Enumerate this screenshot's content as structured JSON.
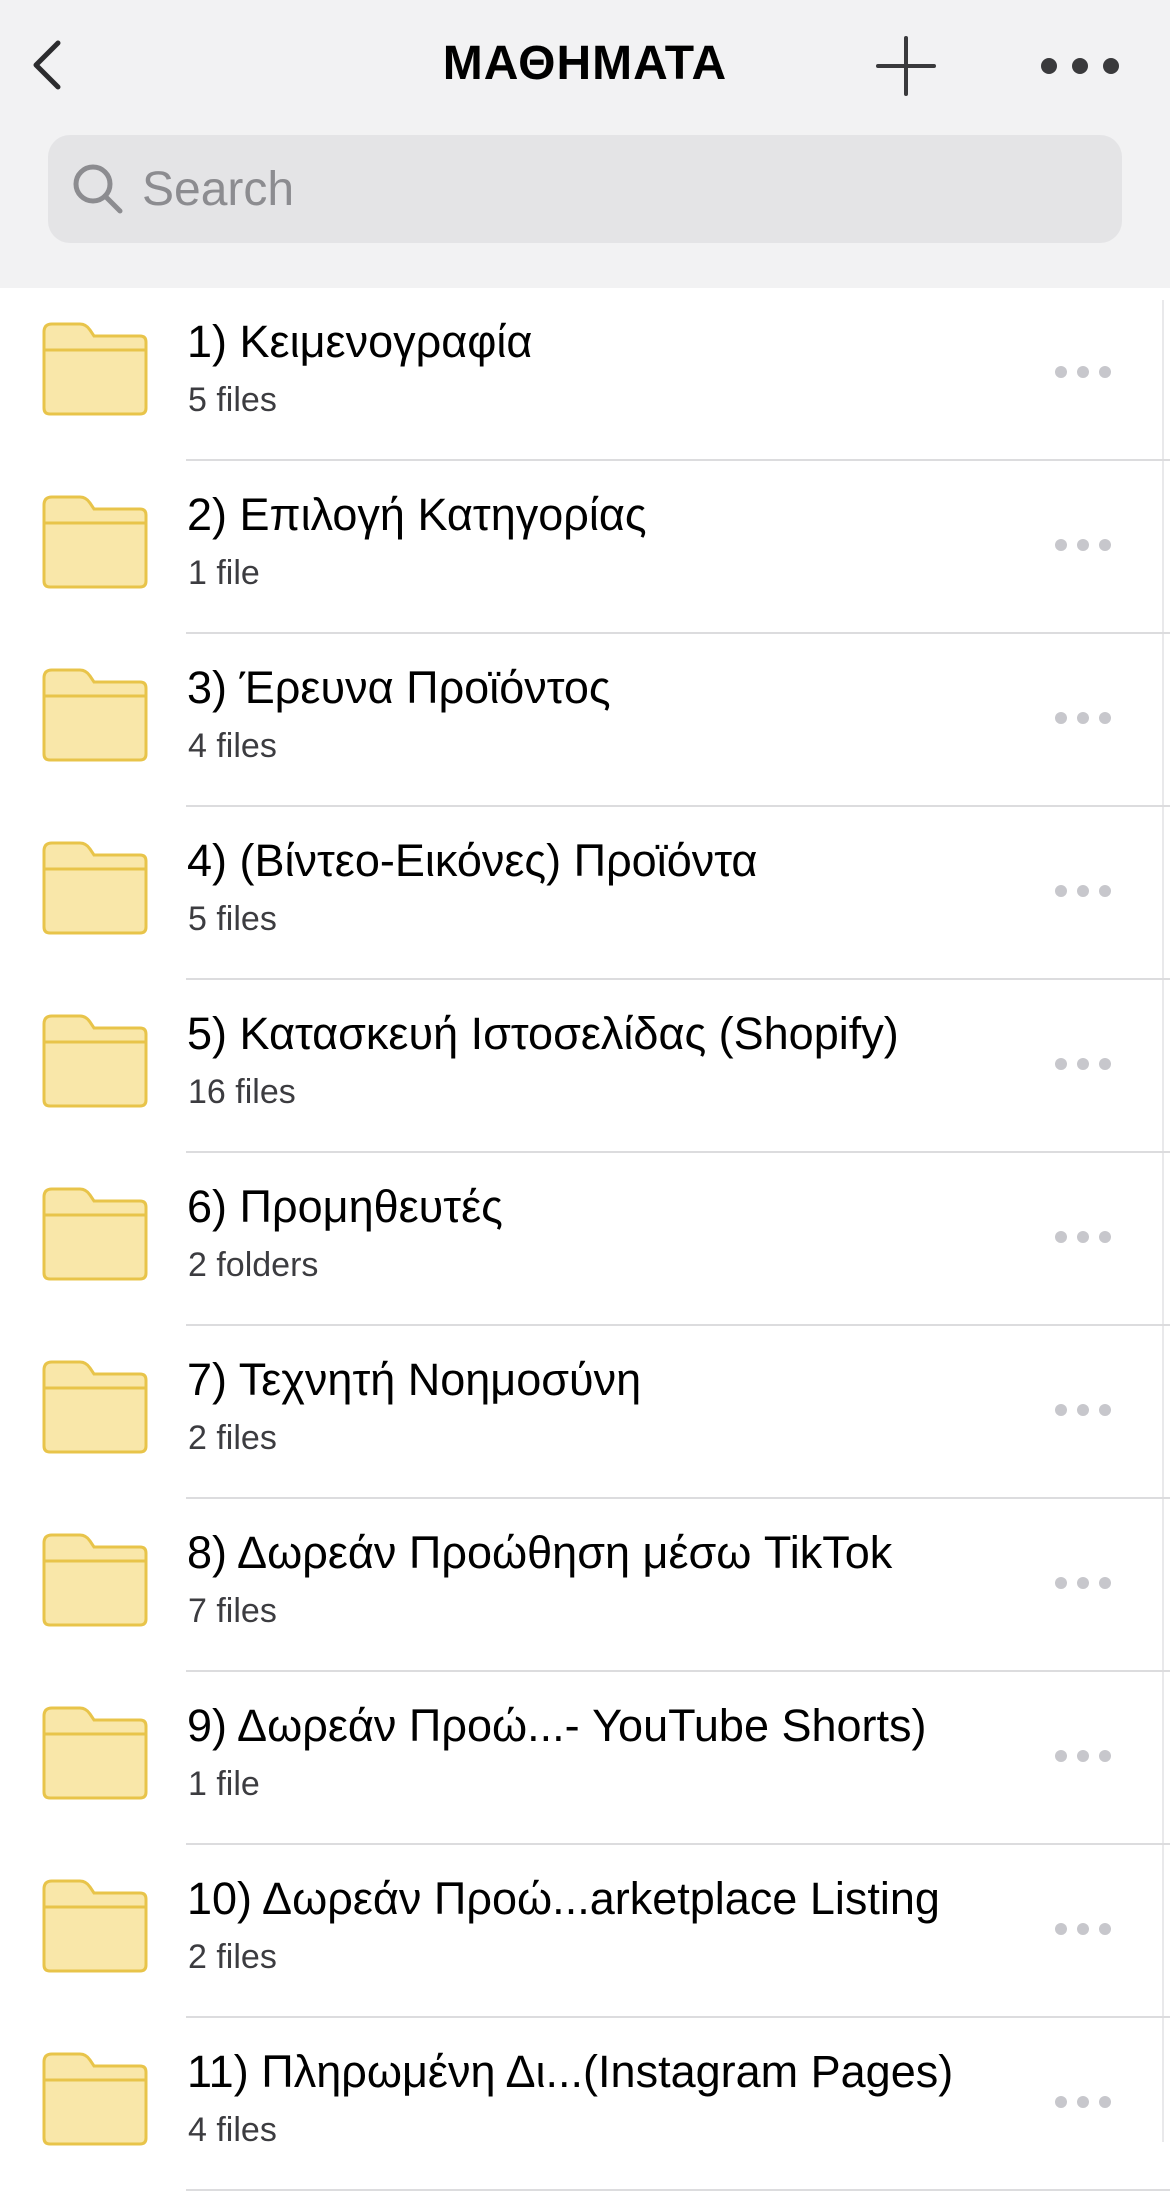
{
  "header": {
    "title": "ΜΑΘΗΜΑΤΑ",
    "back_icon": "chevron-left-icon",
    "add_icon": "plus-icon",
    "more_icon": "ellipsis-icon"
  },
  "search": {
    "placeholder": "Search",
    "value": ""
  },
  "colors": {
    "folder_fill": "#f9e7a9",
    "folder_stroke": "#e8c44a",
    "header_bg": "#f2f2f3",
    "more_dots": "#c7c7cc"
  },
  "folders": [
    {
      "name": "1) Κειμενογραφία",
      "meta": "5 files"
    },
    {
      "name": "2) Επιλογή Κατηγορίας",
      "meta": "1 file"
    },
    {
      "name": "3) Έρευνα Προϊόντος",
      "meta": "4 files"
    },
    {
      "name": "4)  (Βίντεο-Εικόνες) Προϊόντα",
      "meta": "5 files"
    },
    {
      "name": "5) Κατασκευή Ιστοσελίδας (Shopify)",
      "meta": "16 files"
    },
    {
      "name": "6) Προμηθευτές",
      "meta": "2 folders"
    },
    {
      "name": "7) Τεχνητή Νοημοσύνη",
      "meta": "2 files"
    },
    {
      "name": "8) Δωρεάν Προώθηση μέσω TikTok",
      "meta": "7 files"
    },
    {
      "name": "9) Δωρεάν Προώ...- YouTube Shorts)",
      "meta": "1 file"
    },
    {
      "name": "10) Δωρεάν Προώ...arketplace Listing",
      "meta": "2 files"
    },
    {
      "name": "11) Πληρωμένη Δι...(Instagram Pages)",
      "meta": "4 files"
    }
  ]
}
